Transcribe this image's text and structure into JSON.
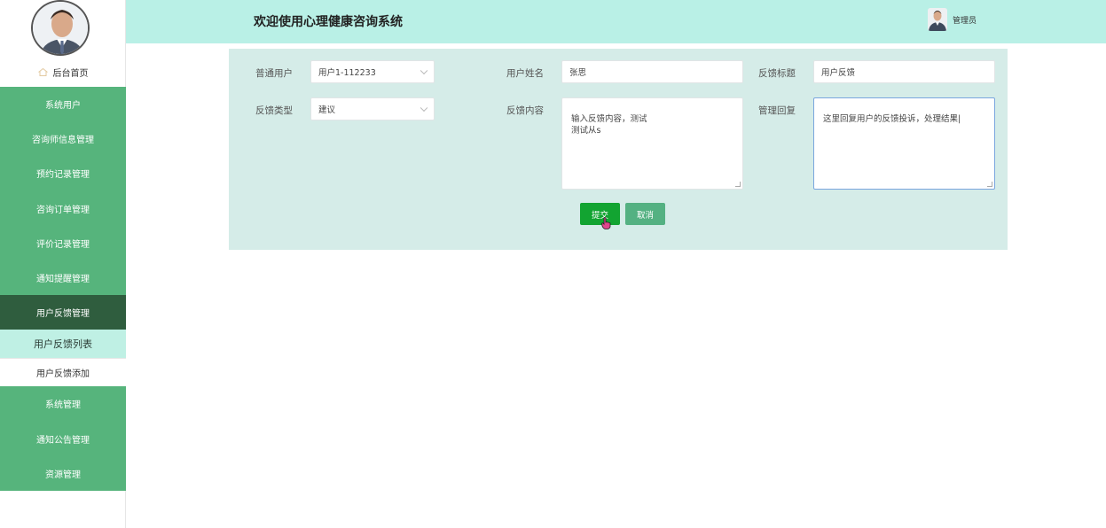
{
  "header": {
    "title": "欢迎使用心理健康咨询系统",
    "user_name": "管理员"
  },
  "sidebar": {
    "home_label": "后台首页",
    "items": [
      {
        "label": "系统用户"
      },
      {
        "label": "咨询师信息管理"
      },
      {
        "label": "预约记录管理"
      },
      {
        "label": "咨询订单管理"
      },
      {
        "label": "评价记录管理"
      },
      {
        "label": "通知提醒管理"
      },
      {
        "label": "用户反馈管理",
        "active": true
      }
    ],
    "sub_items": [
      {
        "label": "用户反馈列表",
        "current": true
      },
      {
        "label": "用户反馈添加"
      }
    ],
    "items_after": [
      {
        "label": "系统管理"
      },
      {
        "label": "通知公告管理"
      },
      {
        "label": "资源管理"
      }
    ]
  },
  "form": {
    "user_label": "普通用户",
    "user_value": "用户1-112233",
    "username_label": "用户姓名",
    "username_value": "张思",
    "title_label": "反馈标题",
    "title_value": "用户反馈",
    "type_label": "反馈类型",
    "type_value": "建议",
    "content_label": "反馈内容",
    "content_value": "输入反馈内容，测试\n测试从s",
    "reply_label": "管理回复",
    "reply_value": "这里回复用户的反馈投诉，处理结果|",
    "submit_label": "提交",
    "cancel_label": "取消"
  },
  "colors": {
    "sidebar_green": "#56b47c",
    "sidebar_active": "#2f5d3e",
    "topbar": "#b9f0e6",
    "panel": "#d5ece8",
    "submit": "#12a431",
    "cancel": "#54b182"
  }
}
